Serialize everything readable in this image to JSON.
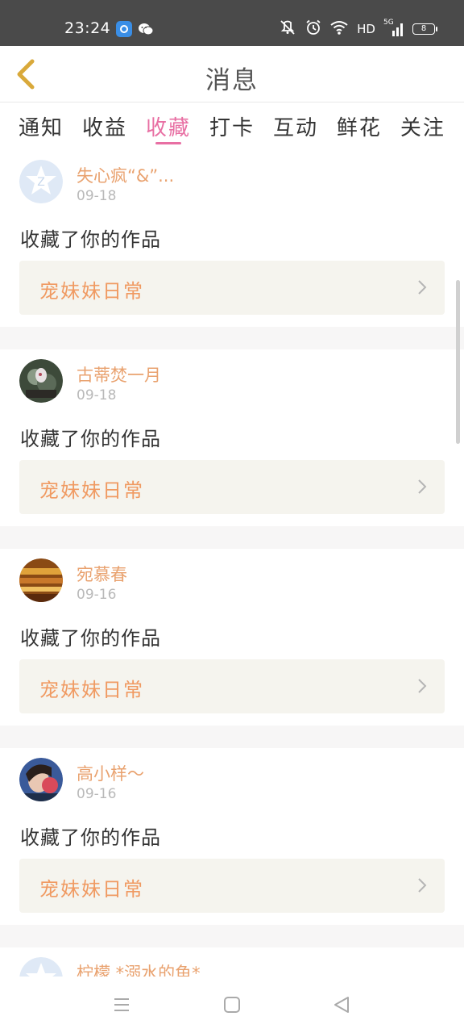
{
  "status_bar": {
    "time": "23:24",
    "network": "HD",
    "signal_label": "5G",
    "battery": "8",
    "icons": [
      "browser-app-icon",
      "wechat-icon",
      "mute-icon",
      "alarm-icon",
      "wifi-icon",
      "signal-icon",
      "battery-icon"
    ]
  },
  "header": {
    "title": "消息",
    "back_icon": "chevron-left-icon"
  },
  "tabs": [
    {
      "label": "通知",
      "active": false
    },
    {
      "label": "收益",
      "active": false
    },
    {
      "label": "收藏",
      "active": true
    },
    {
      "label": "打卡",
      "active": false
    },
    {
      "label": "互动",
      "active": false
    },
    {
      "label": "鲜花",
      "active": false
    },
    {
      "label": "关注",
      "active": false
    }
  ],
  "feed": [
    {
      "user": "失心疯“&”...",
      "date": "09-18",
      "action": "收藏了你的作品",
      "work": "宠妹妹日常",
      "avatar": "default-avatar"
    },
    {
      "user": "古蒂焚一月",
      "date": "09-18",
      "action": "收藏了你的作品",
      "work": "宠妹妹日常",
      "avatar": "photo-avatar"
    },
    {
      "user": "宛慕春",
      "date": "09-16",
      "action": "收藏了你的作品",
      "work": "宠妹妹日常",
      "avatar": "photo-avatar"
    },
    {
      "user": "高小样〜",
      "date": "09-16",
      "action": "收藏了你的作品",
      "work": "宠妹妹日常",
      "avatar": "photo-avatar"
    },
    {
      "user": "柠檬 *溺水的鱼*",
      "avatar": "default-avatar"
    }
  ],
  "colors": {
    "accent": "#e86fa3",
    "username": "#e9a26f",
    "work_title": "#f09a62",
    "back_chevron": "#d9a93a",
    "status_bar": "#4a4a4a"
  },
  "nav_bar": {
    "icons": [
      "menu-icon",
      "home-square-icon",
      "back-triangle-icon"
    ]
  }
}
